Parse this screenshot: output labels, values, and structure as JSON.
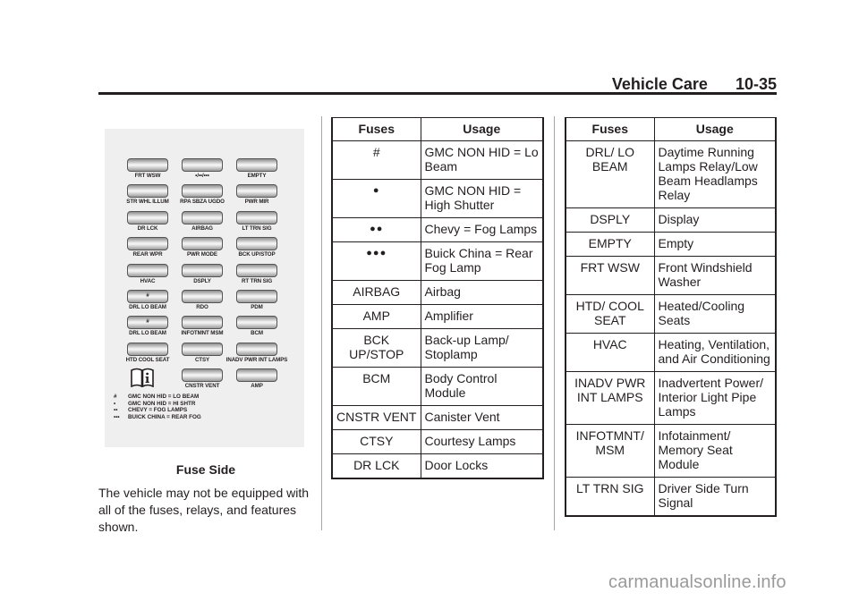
{
  "header": {
    "section_title": "Vehicle Care",
    "page_number": "10-35"
  },
  "diagram": {
    "rows": [
      [
        {
          "label": "FRT WSW",
          "mark": ""
        },
        {
          "label": "•/••/•••",
          "mark": ""
        },
        {
          "label": "EMPTY",
          "mark": ""
        }
      ],
      [
        {
          "label": "STR WHL ILLUM",
          "mark": ""
        },
        {
          "label": "RPA SBZA UGDO",
          "mark": ""
        },
        {
          "label": "PWR MIR",
          "mark": ""
        }
      ],
      [
        {
          "label": "DR LCK",
          "mark": ""
        },
        {
          "label": "AIRBAG",
          "mark": ""
        },
        {
          "label": "LT TRN SIG",
          "mark": ""
        }
      ],
      [
        {
          "label": "REAR WPR",
          "mark": ""
        },
        {
          "label": "PWR MODE",
          "mark": ""
        },
        {
          "label": "BCK UP/STOP",
          "mark": ""
        }
      ],
      [
        {
          "label": "HVAC",
          "mark": ""
        },
        {
          "label": "DSPLY",
          "mark": ""
        },
        {
          "label": "RT TRN SIG",
          "mark": ""
        }
      ],
      [
        {
          "label": "DRL LO BEAM",
          "mark": "#"
        },
        {
          "label": "RDO",
          "mark": ""
        },
        {
          "label": "PDM",
          "mark": ""
        }
      ],
      [
        {
          "label": "DRL LO BEAM",
          "mark": "#"
        },
        {
          "label": "INFOTMNT MSM",
          "mark": ""
        },
        {
          "label": "BCM",
          "mark": ""
        }
      ],
      [
        {
          "label": "HTD COOL SEAT",
          "mark": ""
        },
        {
          "label": "CTSY",
          "mark": ""
        },
        {
          "label": "INADV PWR INT LAMPS",
          "mark": ""
        }
      ],
      [
        null,
        {
          "label": "CNSTR VENT",
          "mark": ""
        },
        {
          "label": "AMP",
          "mark": ""
        }
      ]
    ],
    "legend": [
      {
        "symbol": "#",
        "text": "GMC NON HID = LO BEAM"
      },
      {
        "symbol": "•",
        "text": "GMC NON HID = HI SHTR"
      },
      {
        "symbol": "••",
        "text": "CHEVY = FOG LAMPS"
      },
      {
        "symbol": "•••",
        "text": "BUICK CHINA = REAR FOG"
      }
    ],
    "icon": "owner-manual-info-icon",
    "caption": "Fuse Side"
  },
  "note": "The vehicle may not be equipped with all of the fuses, relays, and features shown.",
  "table_left": {
    "headers": [
      "Fuses",
      "Usage"
    ],
    "rows": [
      {
        "fuse": "#",
        "usage": "GMC NON HID = Lo Beam"
      },
      {
        "fuse": "●",
        "usage": "GMC NON HID = High Shutter"
      },
      {
        "fuse": "●●",
        "usage": "Chevy = Fog Lamps"
      },
      {
        "fuse": "●●●",
        "usage": "Buick China = Rear Fog Lamp"
      },
      {
        "fuse": "AIRBAG",
        "usage": "Airbag"
      },
      {
        "fuse": "AMP",
        "usage": "Amplifier"
      },
      {
        "fuse": "BCK UP/STOP",
        "usage": "Back-up Lamp/ Stoplamp"
      },
      {
        "fuse": "BCM",
        "usage": "Body Control Module"
      },
      {
        "fuse": "CNSTR VENT",
        "usage": "Canister Vent"
      },
      {
        "fuse": "CTSY",
        "usage": "Courtesy Lamps"
      },
      {
        "fuse": "DR LCK",
        "usage": "Door Locks"
      }
    ]
  },
  "table_right": {
    "headers": [
      "Fuses",
      "Usage"
    ],
    "rows": [
      {
        "fuse": "DRL/ LO BEAM",
        "usage": "Daytime Running Lamps Relay/Low Beam Headlamps Relay"
      },
      {
        "fuse": "DSPLY",
        "usage": "Display"
      },
      {
        "fuse": "EMPTY",
        "usage": "Empty"
      },
      {
        "fuse": "FRT WSW",
        "usage": "Front Windshield Washer"
      },
      {
        "fuse": "HTD/ COOL SEAT",
        "usage": "Heated/Cooling Seats"
      },
      {
        "fuse": "HVAC",
        "usage": "Heating, Ventilation, and Air Conditioning"
      },
      {
        "fuse": "INADV PWR INT LAMPS",
        "usage": "Inadvertent Power/ Interior Light Pipe Lamps"
      },
      {
        "fuse": "INFOTMNT/ MSM",
        "usage": "Infotainment/ Memory Seat Module"
      },
      {
        "fuse": "LT TRN SIG",
        "usage": "Driver Side Turn Signal"
      }
    ]
  },
  "watermark": "carmanualsonline.info"
}
